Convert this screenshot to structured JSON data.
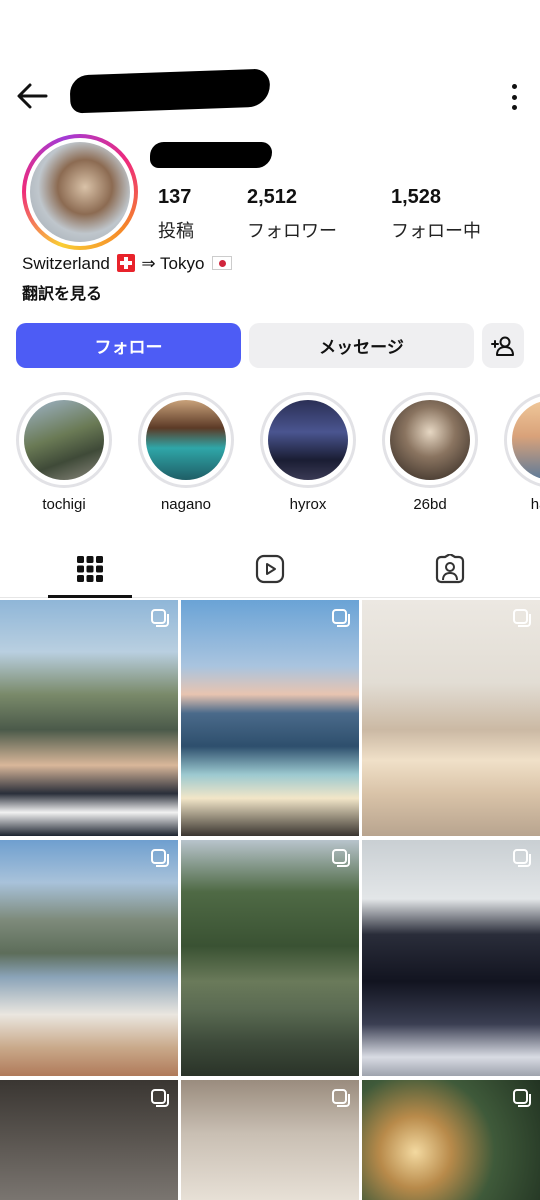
{
  "stats": {
    "posts": {
      "value": "137",
      "label": "投稿"
    },
    "followers": {
      "value": "2,512",
      "label": "フォロワー"
    },
    "following": {
      "value": "1,528",
      "label": "フォロー中"
    }
  },
  "bio": {
    "from": "Switzerland",
    "arrow": "⇒",
    "to": "Tokyo",
    "translate": "翻訳を見る"
  },
  "actions": {
    "follow": "フォロー",
    "message": "メッセージ"
  },
  "highlights": [
    "tochigi",
    "nagano",
    "hyrox",
    "26bd",
    "hawaii"
  ],
  "icons": {
    "back": "arrow-left-icon",
    "more": "more-vertical-icon",
    "add_user": "add-user-icon",
    "grid_tab": "grid-icon",
    "reels_tab": "reels-icon",
    "tagged_tab": "tagged-icon",
    "multi_post": "carousel-icon"
  },
  "colors": {
    "follow_button": "#4d5cf5",
    "secondary_button": "#efeff1",
    "story_ring": "#ee2a7b"
  }
}
